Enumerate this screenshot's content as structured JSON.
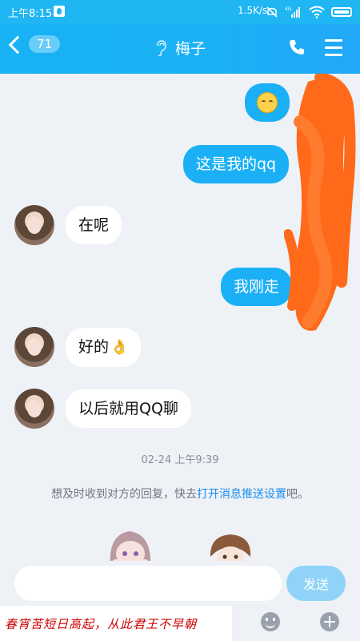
{
  "status_bar": {
    "time": "上午8:15",
    "net_speed": "1.5K/s",
    "network_type": "4G",
    "icons": [
      "app-icon",
      "mute-icon",
      "signal-icon",
      "wifi-icon",
      "battery-icon"
    ]
  },
  "header": {
    "unread_count": "71",
    "title": "梅子",
    "icons": [
      "back-chevron-icon",
      "earpiece-icon",
      "phone-icon",
      "menu-icon"
    ],
    "background_color": "#1bb0f5"
  },
  "messages": [
    {
      "direction": "out",
      "type": "emoji",
      "emoji": "relieved-face-emoji",
      "text": ""
    },
    {
      "direction": "out",
      "type": "text",
      "text": "这是我的qq"
    },
    {
      "direction": "in",
      "type": "text",
      "text": "在呢"
    },
    {
      "direction": "out",
      "type": "text",
      "text": "我刚走"
    },
    {
      "direction": "in",
      "type": "text",
      "text": "好的",
      "emoji": "ok-hand-emoji"
    },
    {
      "direction": "in",
      "type": "text",
      "text": "以后就用QQ聊"
    }
  ],
  "timestamp": "02-24 上午9:39",
  "notice": {
    "prefix": "想及时收到对方的回复，快去",
    "link": "打开消息推送设置",
    "suffix": "吧。"
  },
  "composer": {
    "placeholder": "",
    "send_label": "发送"
  },
  "bottom": {
    "poem_overlay": "春宵苦短日高起，从此君王不早朝",
    "icons": [
      "emoji-panel-icon",
      "plus-icon"
    ]
  },
  "colors": {
    "outgoing_bubble": "#1bb0f6",
    "incoming_bubble": "#ffffff",
    "chat_background": "#eef1f6",
    "link": "#1a8ff2",
    "redaction": "#ff6a1a"
  }
}
